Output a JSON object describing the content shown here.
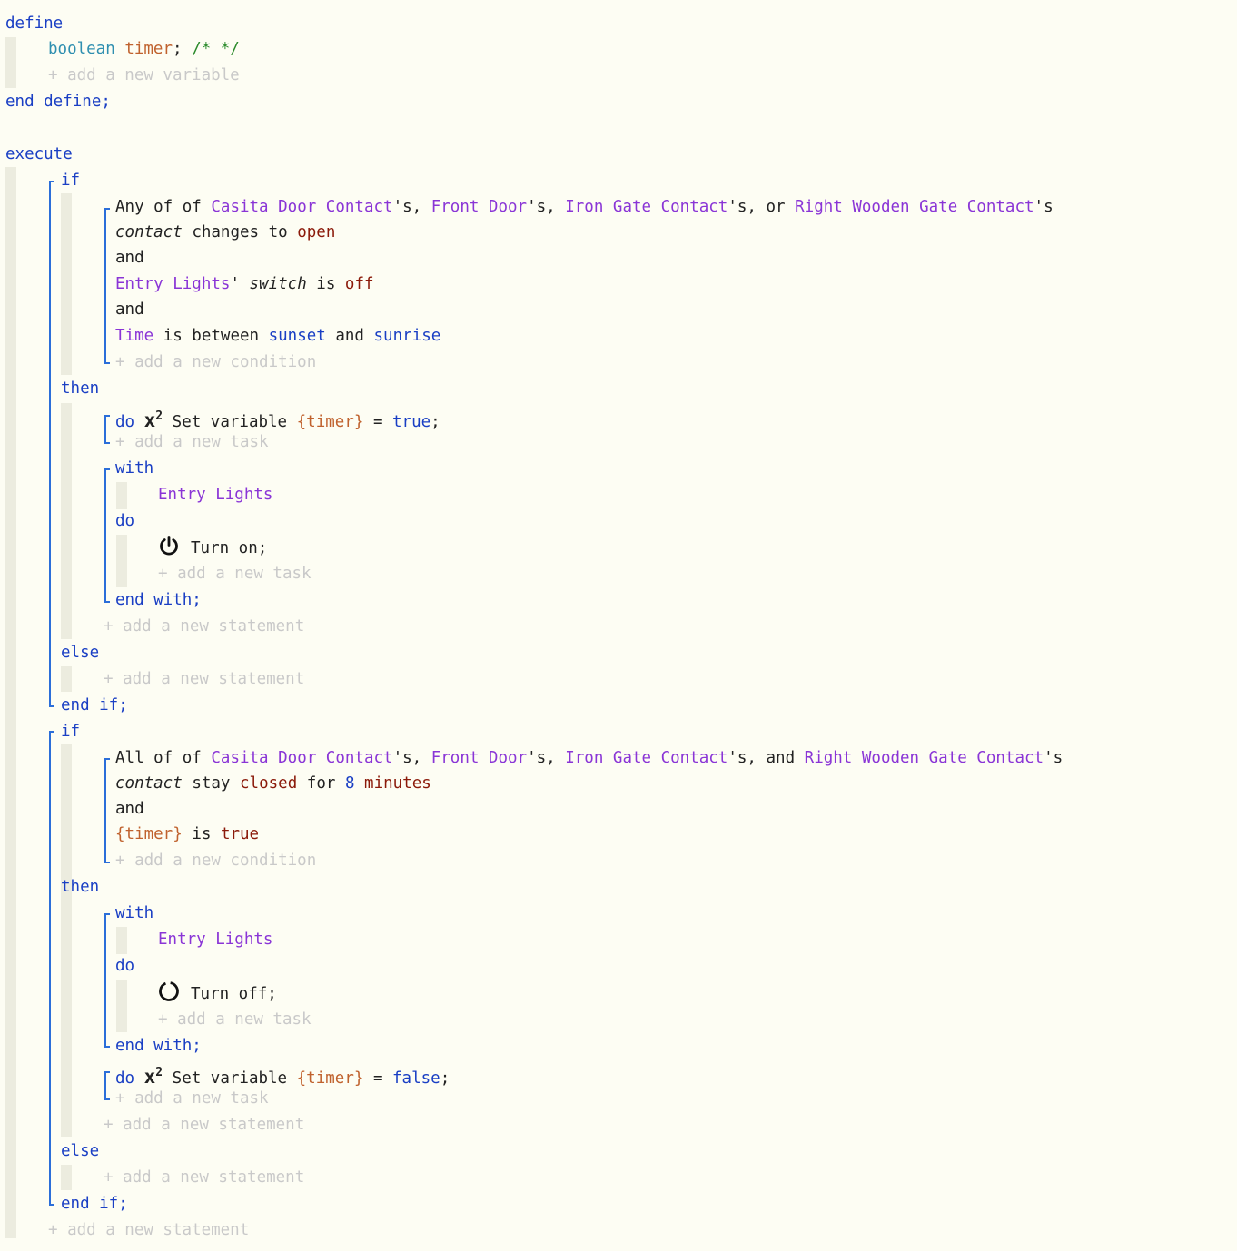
{
  "kw": {
    "define": "define",
    "boolean": "boolean",
    "end_define": "end define;",
    "execute": "execute",
    "if": "if",
    "then": "then",
    "else": "else",
    "end_if": "end if;",
    "with": "with",
    "do": "do",
    "end_with": "end with;",
    "and": "and"
  },
  "variable": {
    "name": "timer",
    "comment": "/* */"
  },
  "placeholders": {
    "add_variable": "+ add a new variable",
    "add_condition": "+ add a new condition",
    "add_task": "+ add a new task",
    "add_statement": "+ add a new statement"
  },
  "devices": {
    "casita": "Casita Door Contact",
    "front": "Front Door",
    "iron": "Iron Gate Contact",
    "right": "Right Wooden Gate Contact",
    "entry": "Entry Lights"
  },
  "if1": {
    "any_of": "Any of",
    "attr": "contact",
    "changes_to": "changes to",
    "open": "open",
    "switch": "switch",
    "is": "is",
    "off": "off",
    "time": "Time",
    "is_between": "is between",
    "sunset": "sunset",
    "sunrise": "sunrise",
    "set_variable": "Set variable",
    "timer_ref": "{timer}",
    "true_val": "true",
    "turn_on": "Turn on;"
  },
  "if2": {
    "all_of": "All of",
    "stay": "stay",
    "closed": "closed",
    "for": "for",
    "eight": "8",
    "minutes": "minutes",
    "is": "is",
    "true_val": "true",
    "false_val": "false",
    "turn_off": "Turn off;"
  },
  "icons": {
    "variable": "x-squared-icon",
    "power_on": "power-icon",
    "power_off": "power-off-icon"
  },
  "colors": {
    "keyword": "#1a3fc4",
    "device": "#8a35d6",
    "value": "#8b1a0a",
    "variable": "#c0622e",
    "type": "#2f8fb0",
    "comment": "#2a8a2a",
    "placeholder": "#c9c9c9",
    "bracket": "#2b6ed9",
    "background": "#fdfdf3"
  }
}
